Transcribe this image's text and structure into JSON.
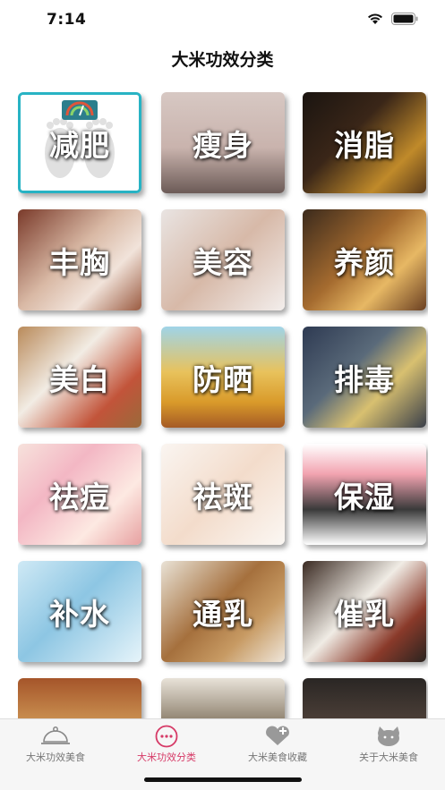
{
  "status": {
    "time": "7:14"
  },
  "header": {
    "title": "大米功效分类"
  },
  "tiles": [
    {
      "label": "减肥",
      "bg": "linear-gradient(135deg,#ffffff,#e9e9e9)"
    },
    {
      "label": "瘦身",
      "bg": "linear-gradient(180deg,#d7c8c3 0%,#c9b3ad 55%,#6c5b57 100%)"
    },
    {
      "label": "消脂",
      "bg": "linear-gradient(135deg,#1a1410 0%,#3a2618 40%,#c08a2a 75%,#5a3a1a 100%)"
    },
    {
      "label": "丰胸",
      "bg": "linear-gradient(135deg,#7a3a2a 0%,#d9b9a5 45%,#f1e3da 70%,#9a5a40 100%)"
    },
    {
      "label": "美容",
      "bg": "linear-gradient(135deg,#e9e4e2 0%,#d7b9a8 50%,#f3eeec 100%)"
    },
    {
      "label": "养颜",
      "bg": "linear-gradient(135deg,#3b2a1c 0%,#a56b2f 45%,#e7b864 70%,#6a3f22 100%)"
    },
    {
      "label": "美白",
      "bg": "linear-gradient(135deg,#b98a5a 0%,#f2ece4 40%,#c2543a 75%,#9a6a3a 100%)"
    },
    {
      "label": "防晒",
      "bg": "linear-gradient(180deg,#9fd4e8 0%,#e8c25c 45%,#d99a2a 75%,#a55a25 100%)"
    },
    {
      "label": "排毒",
      "bg": "linear-gradient(135deg,#2e3a52 0%,#5a6a7a 40%,#d8c070 65%,#3a3f4a 100%)"
    },
    {
      "label": "祛痘",
      "bg": "linear-gradient(135deg,#f7e2dc 0%,#f3b7c4 35%,#fde9e2 70%,#e7a1a1 100%)"
    },
    {
      "label": "祛斑",
      "bg": "linear-gradient(135deg,#faf5f1 0%,#f3dccb 50%,#fbf7f3 100%)"
    },
    {
      "label": "保湿",
      "bg": "linear-gradient(180deg,#ffffff 0%,#f2a3b0 30%,#3a3a3a 65%,#ffffff 100%)"
    },
    {
      "label": "补水",
      "bg": "linear-gradient(135deg,#cfe9f5 0%,#8dc6e3 45%,#e6f4fa 100%)"
    },
    {
      "label": "通乳",
      "bg": "linear-gradient(135deg,#e9e2d6 0%,#a5703d 45%,#c79a63 70%,#efe6da 100%)"
    },
    {
      "label": "催乳",
      "bg": "linear-gradient(135deg,#3a2a22 0%,#f0ece5 45%,#8a3a2a 75%,#2a2420 100%)"
    },
    {
      "label": "",
      "bg": "linear-gradient(180deg,#a5552a 0%,#d9a860 60%,#b9783a 100%)"
    },
    {
      "label": "",
      "bg": "linear-gradient(180deg,#e8e2d8 0%,#6a5a44 60%,#3a2e22 100%)"
    },
    {
      "label": "",
      "bg": "linear-gradient(180deg,#2a2624 0%,#5a4a40 60%,#1a1816 100%)"
    }
  ],
  "tabbar": {
    "tabs": [
      {
        "label": "大米功效美食",
        "icon": "cloche-icon"
      },
      {
        "label": "大米功效分类",
        "icon": "chat-bubble-icon",
        "active": true
      },
      {
        "label": "大米美食收藏",
        "icon": "heart-plus-icon"
      },
      {
        "label": "关于大米美食",
        "icon": "cat-face-icon"
      }
    ]
  },
  "colors": {
    "accent": "#d63a67",
    "selected_border": "#28b3c4"
  }
}
